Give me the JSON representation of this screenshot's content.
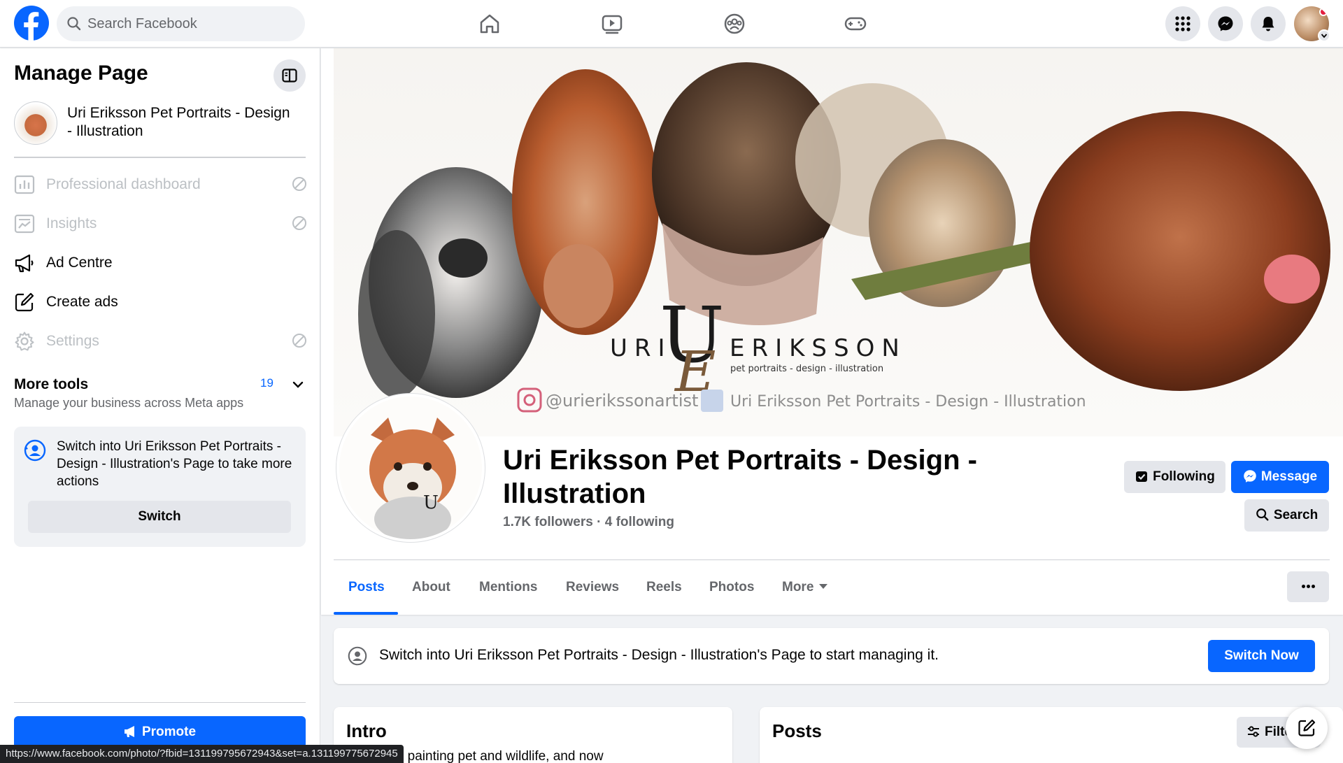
{
  "topbar": {
    "search_placeholder": "Search Facebook"
  },
  "sidebar": {
    "title": "Manage Page",
    "page_name": "Uri Eriksson Pet Portraits - Design - Illustration",
    "items": [
      {
        "label": "Professional dashboard",
        "disabled": true
      },
      {
        "label": "Insights",
        "disabled": true
      },
      {
        "label": "Ad Centre",
        "disabled": false
      },
      {
        "label": "Create ads",
        "disabled": false
      },
      {
        "label": "Settings",
        "disabled": true
      }
    ],
    "more_tools": {
      "title": "More tools",
      "count": "19",
      "subtitle": "Manage your business across Meta apps"
    },
    "switch_card": {
      "text": "Switch into Uri Eriksson Pet Portraits - Design - Illustration's Page to take more actions",
      "button": "Switch"
    },
    "promote_label": "Promote"
  },
  "cover": {
    "brand_left": "URI",
    "brand_right": "ERIKSSON",
    "tagline": "pet portraits - design - illustration",
    "instagram": "@urierikssonartist",
    "facebook": "Uri Eriksson Pet Portraits - Design - Illustration"
  },
  "profile": {
    "name": "Uri Eriksson Pet Portraits - Design - Illustration",
    "followers": "1.7K followers",
    "following": "4 following",
    "buttons": {
      "following": "Following",
      "message": "Message",
      "search": "Search"
    }
  },
  "tabs": [
    "Posts",
    "About",
    "Mentions",
    "Reviews",
    "Reels",
    "Photos",
    "More"
  ],
  "notice": {
    "text": "Switch into Uri Eriksson Pet Portraits - Design - Illustration's Page to start managing it.",
    "button": "Switch Now"
  },
  "intro": {
    "title": "Intro",
    "text_fragment": "t focus on painting pet and wildlife, and now"
  },
  "posts": {
    "title": "Posts",
    "filter_label": "Filters"
  },
  "status_bar": {
    "url": "https://www.facebook.com/photo/?fbid=131199795672943&set=a.131199775672945"
  },
  "colors": {
    "brand_blue": "#0866ff",
    "background": "#f0f2f5",
    "secondary_text": "#65676b"
  }
}
